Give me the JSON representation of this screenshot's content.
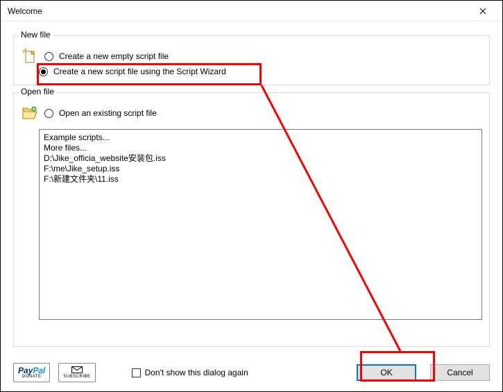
{
  "window": {
    "title": "Welcome"
  },
  "group_new": {
    "label": "New file",
    "opt_empty": "Create a new empty script file",
    "opt_wizard": "Create a new script file using the Script Wizard"
  },
  "group_open": {
    "label": "Open file",
    "opt_existing": "Open an existing script file",
    "files": [
      "Example scripts...",
      "More files...",
      "D:\\Jike_officia_website安装包.iss",
      "F:\\me\\Jike_setup.iss",
      "F:\\新建文件夹\\11.iss"
    ]
  },
  "footer": {
    "paypal_main_a": "Pay",
    "paypal_main_b": "Pal",
    "paypal_sub": "DONATE",
    "subscribe_sub": "SUBSCRIBE",
    "dont_show": "Don't show this dialog again",
    "ok": "OK",
    "cancel": "Cancel"
  }
}
